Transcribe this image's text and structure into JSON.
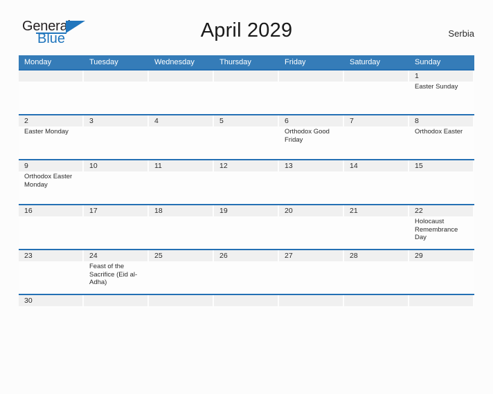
{
  "brand": {
    "name_part1": "General",
    "name_part2": "Blue",
    "triangle_icon": "triangle-icon"
  },
  "header": {
    "title": "April 2029",
    "region": "Serbia"
  },
  "calendar": {
    "weekday_headers": [
      "Monday",
      "Tuesday",
      "Wednesday",
      "Thursday",
      "Friday",
      "Saturday",
      "Sunday"
    ],
    "weeks": [
      {
        "days": [
          {
            "num": "",
            "events": []
          },
          {
            "num": "",
            "events": []
          },
          {
            "num": "",
            "events": []
          },
          {
            "num": "",
            "events": []
          },
          {
            "num": "",
            "events": []
          },
          {
            "num": "",
            "events": []
          },
          {
            "num": "1",
            "events": [
              "Easter Sunday"
            ]
          }
        ]
      },
      {
        "days": [
          {
            "num": "2",
            "events": [
              "Easter Monday"
            ]
          },
          {
            "num": "3",
            "events": []
          },
          {
            "num": "4",
            "events": []
          },
          {
            "num": "5",
            "events": []
          },
          {
            "num": "6",
            "events": [
              "Orthodox Good Friday"
            ]
          },
          {
            "num": "7",
            "events": []
          },
          {
            "num": "8",
            "events": [
              "Orthodox Easter"
            ]
          }
        ]
      },
      {
        "days": [
          {
            "num": "9",
            "events": [
              "Orthodox Easter Monday"
            ]
          },
          {
            "num": "10",
            "events": []
          },
          {
            "num": "11",
            "events": []
          },
          {
            "num": "12",
            "events": []
          },
          {
            "num": "13",
            "events": []
          },
          {
            "num": "14",
            "events": []
          },
          {
            "num": "15",
            "events": []
          }
        ]
      },
      {
        "days": [
          {
            "num": "16",
            "events": []
          },
          {
            "num": "17",
            "events": []
          },
          {
            "num": "18",
            "events": []
          },
          {
            "num": "19",
            "events": []
          },
          {
            "num": "20",
            "events": []
          },
          {
            "num": "21",
            "events": []
          },
          {
            "num": "22",
            "events": [
              "Holocaust Remembrance Day"
            ]
          }
        ]
      },
      {
        "days": [
          {
            "num": "23",
            "events": []
          },
          {
            "num": "24",
            "events": [
              "Feast of the Sacrifice (Eid al-Adha)"
            ]
          },
          {
            "num": "25",
            "events": []
          },
          {
            "num": "26",
            "events": []
          },
          {
            "num": "27",
            "events": []
          },
          {
            "num": "28",
            "events": []
          },
          {
            "num": "29",
            "events": []
          }
        ]
      },
      {
        "short": true,
        "days": [
          {
            "num": "30",
            "events": []
          },
          {
            "num": "",
            "events": []
          },
          {
            "num": "",
            "events": []
          },
          {
            "num": "",
            "events": []
          },
          {
            "num": "",
            "events": []
          },
          {
            "num": "",
            "events": []
          },
          {
            "num": "",
            "events": []
          }
        ]
      }
    ]
  },
  "colors": {
    "header_blue": "#357cb8",
    "rule_blue": "#2470b4",
    "logo_blue": "#2176bd",
    "day_strip_gray": "#f0f0f0",
    "page_bg": "#fcfcfc"
  }
}
